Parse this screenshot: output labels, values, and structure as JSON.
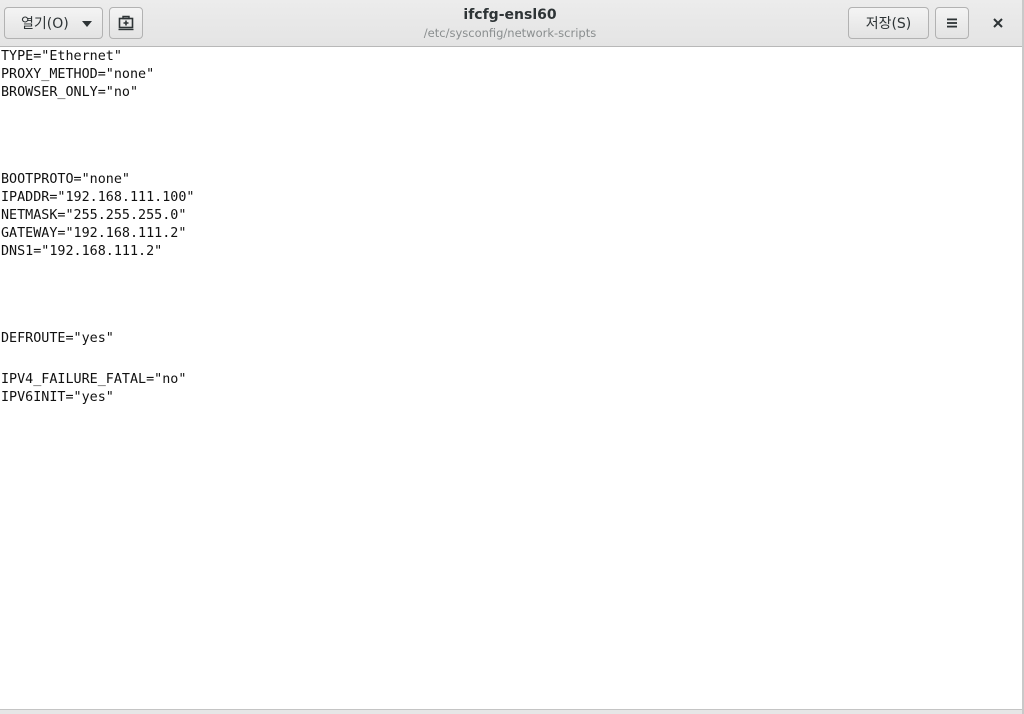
{
  "header": {
    "open_label": "열기(O)",
    "title": "ifcfg-ensl60",
    "subtitle": "/etc/sysconfig/network-scripts",
    "save_label": "저장(S)"
  },
  "icons": {
    "open_menu": "chevron-down-icon",
    "new_tab": "new-document-icon",
    "menu": "hamburger-menu-icon",
    "close": "close-icon"
  },
  "editor": {
    "lines": [
      "TYPE=\"Ethernet\"",
      "PROXY_METHOD=\"none\"",
      "BROWSER_ONLY=\"no\"",
      "BOOTPROTO=\"none\"",
      "IPADDR=\"192.168.111.100\"",
      "NETMASK=\"255.255.255.0\"",
      "GATEWAY=\"192.168.111.2\"",
      "DNS1=\"192.168.111.2\"",
      "DEFROUTE=\"yes\"",
      "IPV4_FAILURE_FATAL=\"no\"",
      "IPV6INIT=\"yes\""
    ]
  }
}
